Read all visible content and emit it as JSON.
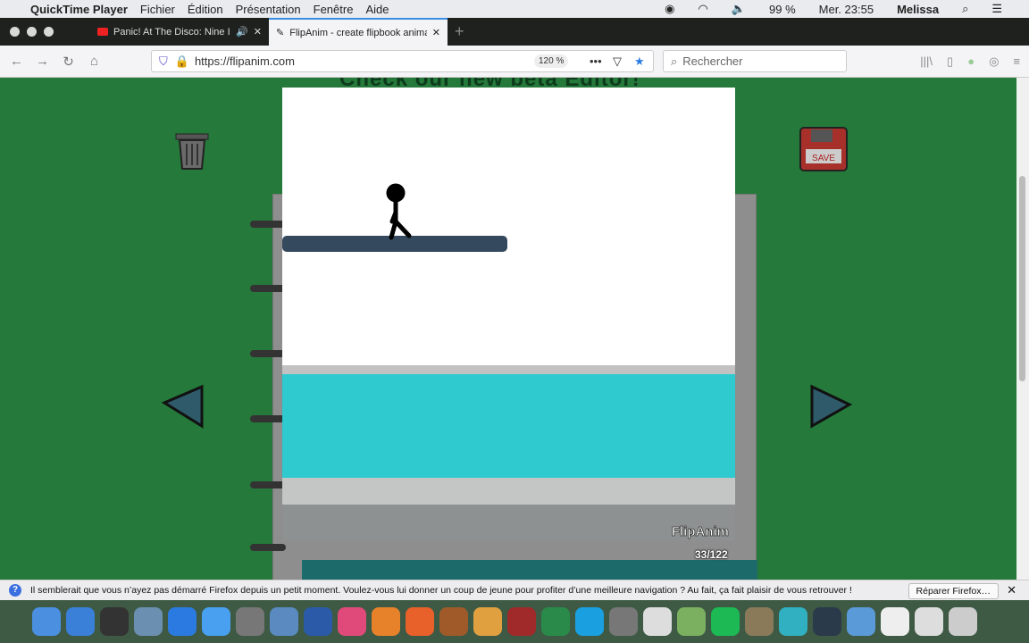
{
  "menubar": {
    "app": "QuickTime Player",
    "items": [
      "Fichier",
      "Édition",
      "Présentation",
      "Fenêtre",
      "Aide"
    ],
    "battery": "99 %",
    "clock": "Mer. 23:55",
    "user": "Melissa"
  },
  "tabs": [
    {
      "title": "Panic! At The Disco: Nine In the Afternoon",
      "active": false
    },
    {
      "title": "FlipAnim - create flipbook animations",
      "active": true
    }
  ],
  "nav": {
    "url": "https://flipanim.com",
    "zoom": "120 %",
    "search_placeholder": "Rechercher"
  },
  "page": {
    "banner": "Check our new beta Editor!",
    "logo": "FlipAnim",
    "frame_counter": "33/122"
  },
  "notification": {
    "text": "Il semblerait que vous n’ayez pas démarré Firefox depuis un petit moment. Voulez-vous lui donner un coup de jeune pour profiter d’une meilleure navigation ? Au fait, ça fait plaisir de vous retrouver !",
    "button": "Réparer Firefox…"
  },
  "colors": {
    "page_bg": "#25793a",
    "water": "#2ecad0",
    "platform": "#34495e"
  },
  "dock_icons": [
    "finder",
    "launchpad",
    "dashboard",
    "preview",
    "safari",
    "messages",
    "photos-browser",
    "mail",
    "word",
    "itunes",
    "books",
    "firefox",
    "garageband",
    "photos",
    "photo-booth",
    "time-machine",
    "skype",
    "system-preferences",
    "chrome",
    "maps",
    "spotify",
    "gimp",
    "wunderlist",
    "quicktime",
    "folder",
    "document",
    "document",
    "trash"
  ]
}
